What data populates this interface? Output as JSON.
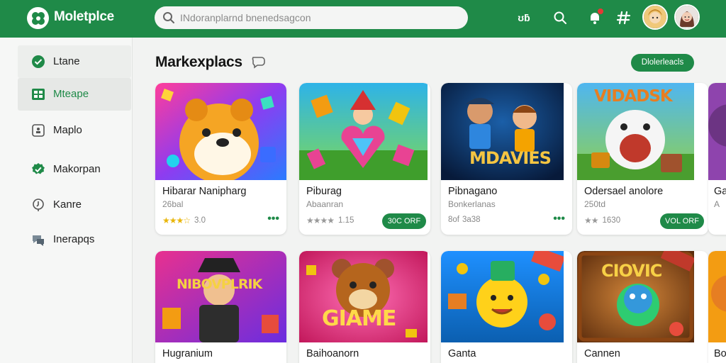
{
  "app": {
    "brand": "Moletplce"
  },
  "search": {
    "placeholder": "INdoranplarnd bnenedsagcon"
  },
  "topbar": {
    "icon_text": "ʊƃ"
  },
  "sidebar": {
    "items": [
      {
        "label": "Ltane",
        "icon": "check-circle-icon",
        "active": true
      },
      {
        "label": "Mteape",
        "icon": "grid-icon",
        "active": true
      },
      {
        "label": "Maplo",
        "icon": "puzzle-icon",
        "active": false
      },
      {
        "label": "Makorpan",
        "icon": "check-badge-icon",
        "active": false
      },
      {
        "label": "Kanre",
        "icon": "location-icon",
        "active": false
      },
      {
        "label": "Inerapqs",
        "icon": "chat-icon",
        "active": false
      }
    ]
  },
  "main": {
    "title": "Markexplacs",
    "see_all_label": "Dlolerleacls",
    "row1": [
      {
        "title": "Hibarar Nanipharg",
        "sub": "26bal",
        "rating": "3.0",
        "action": "more",
        "stars_color": "gold"
      },
      {
        "title": "Piburag",
        "sub": "Abaanran",
        "rating": "1.15",
        "action": "price",
        "price": "30C ORF"
      },
      {
        "title": "Pibnagano",
        "sub": "Bonkerlanas",
        "rating": "3a38",
        "action": "more",
        "rating_prefix": "8of"
      },
      {
        "title": "Odersael anolore",
        "sub": "250td",
        "rating": "1630",
        "action": "price",
        "price": "VOL ORF"
      },
      {
        "title": "Ga",
        "sub": "A",
        "rating": "",
        "action": "none"
      }
    ],
    "row2": [
      {
        "title": "Hugranium"
      },
      {
        "title": "Baihoanorn"
      },
      {
        "title": "Ganta"
      },
      {
        "title": "Cannen"
      },
      {
        "title": "Bo"
      }
    ],
    "art_texts": {
      "card3": "MDAVIES",
      "card4": "VIDADSK",
      "card6": "NIBOVPLRIK",
      "card7": "GIAME",
      "card9": "CIOVIC"
    }
  },
  "colors": {
    "accent": "#1f8a48",
    "star": "#e9b60b"
  }
}
